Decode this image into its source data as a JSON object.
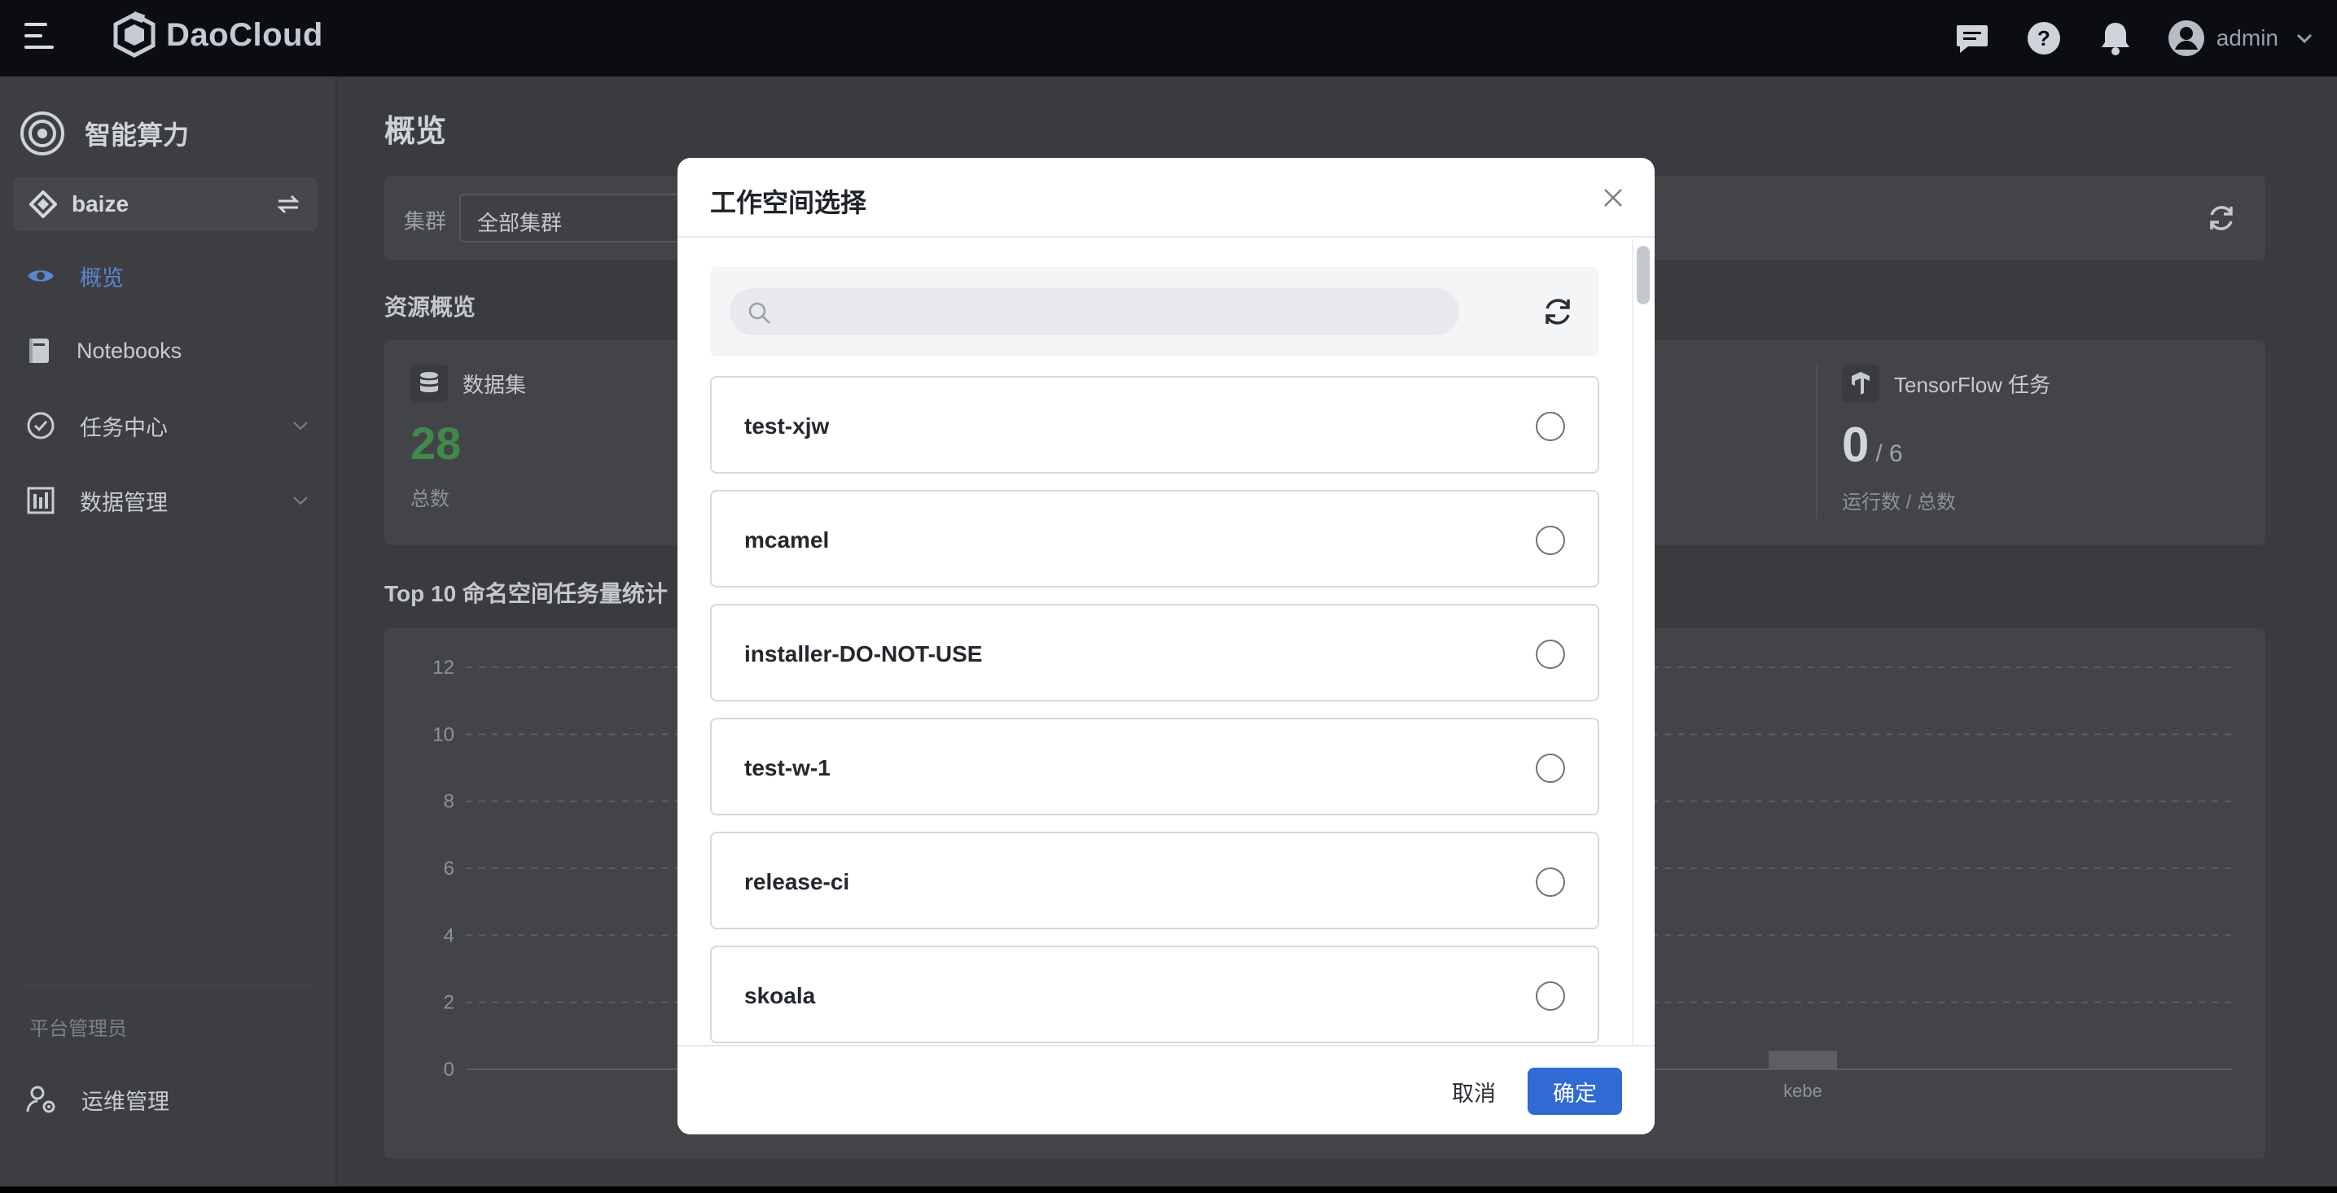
{
  "topbar": {
    "brand": "DaoCloud",
    "icons": [
      "message-icon",
      "help-icon",
      "bell-icon",
      "user-avatar-icon"
    ],
    "username": "admin"
  },
  "sidebar": {
    "module_title": "智能算力",
    "workspace": "baize",
    "items": [
      {
        "label": "概览",
        "icon": "eye-icon",
        "active": true
      },
      {
        "label": "Notebooks",
        "icon": "notebook-icon",
        "active": false
      },
      {
        "label": "任务中心",
        "icon": "task-check-icon",
        "active": false,
        "expandable": true
      },
      {
        "label": "数据管理",
        "icon": "data-management-icon",
        "active": false,
        "expandable": true
      }
    ],
    "section_label": "平台管理员",
    "admin_item": {
      "label": "运维管理",
      "icon": "user-gear-icon"
    }
  },
  "main": {
    "page_title": "概览",
    "filter": {
      "label": "集群",
      "value": "全部集群"
    },
    "resource_section_title": "资源概览",
    "dataset_card": {
      "title": "数据集",
      "value": "28",
      "sub": "总数"
    },
    "tf_card": {
      "title": "TensorFlow 任务",
      "running": "0",
      "total": "/ 6",
      "sub": "运行数 / 总数"
    },
    "chart_section_title": "Top 10 命名空间任务量统计"
  },
  "chart_data": {
    "type": "bar",
    "title": "Top 10 命名空间任务量统计",
    "y_ticks": [
      "12",
      "10",
      "8",
      "6",
      "4",
      "2",
      "0"
    ],
    "ylim": [
      0,
      12
    ],
    "grid": true,
    "categories": [
      "kebe"
    ],
    "values": [
      1
    ]
  },
  "modal": {
    "title": "工作空间选择",
    "search_placeholder": "",
    "options": [
      "test-xjw",
      "mcamel",
      "installer-DO-NOT-USE",
      "test-w-1",
      "release-ci",
      "skoala"
    ],
    "cancel_label": "取消",
    "ok_label": "确定"
  },
  "colors": {
    "accent": "#2f6bd2",
    "topbar_bg": "#0b0d12",
    "dataset_value": "#3f8a4a",
    "active_nav": "#5b86cf"
  }
}
